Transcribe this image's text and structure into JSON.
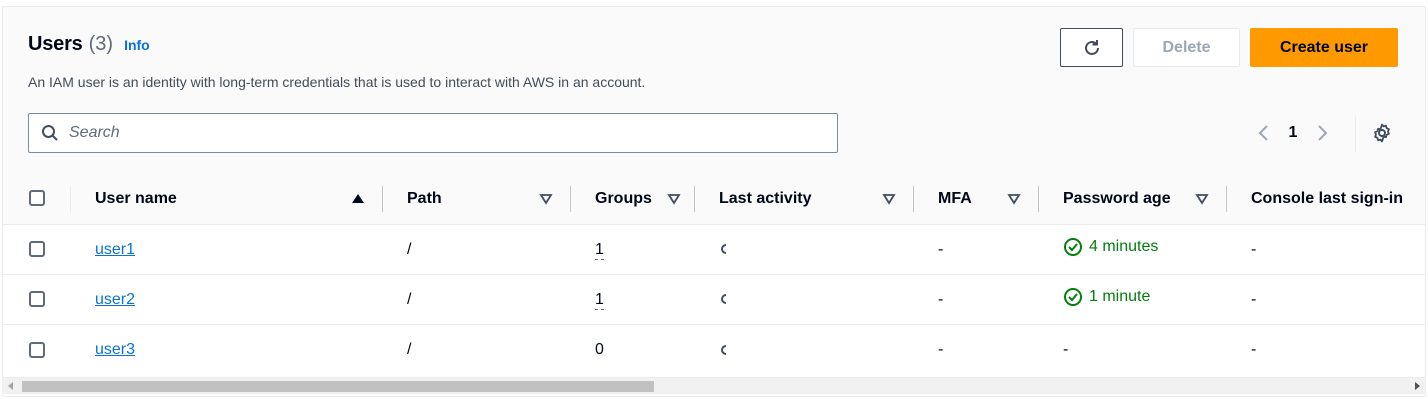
{
  "header": {
    "title": "Users",
    "count": "(3)",
    "info_label": "Info",
    "description": "An IAM user is an identity with long-term credentials that is used to interact with AWS in an account."
  },
  "actions": {
    "refresh_icon": "refresh-icon",
    "delete_label": "Delete",
    "create_label": "Create user"
  },
  "search": {
    "placeholder": "Search",
    "value": ""
  },
  "pagination": {
    "current_page": "1"
  },
  "table": {
    "columns": [
      "User name",
      "Path",
      "Groups",
      "Last activity",
      "MFA",
      "Password age",
      "Console last sign-in"
    ],
    "sorted_column": "User name",
    "sort_direction": "ascending",
    "rows": [
      {
        "user_name": "user1",
        "path": "/",
        "groups": "1",
        "last_activity": "",
        "mfa": "-",
        "password_age": "4 minutes",
        "console_last_sign_in": "-"
      },
      {
        "user_name": "user2",
        "path": "/",
        "groups": "1",
        "last_activity": "",
        "mfa": "-",
        "password_age": "1 minute",
        "console_last_sign_in": "-"
      },
      {
        "user_name": "user3",
        "path": "/",
        "groups": "0",
        "last_activity": "",
        "mfa": "-",
        "password_age": "-",
        "console_last_sign_in": "-"
      }
    ]
  },
  "colors": {
    "primary_button": "#ff9900",
    "link": "#0972d3",
    "success": "#037f0c",
    "text": "#000716"
  }
}
